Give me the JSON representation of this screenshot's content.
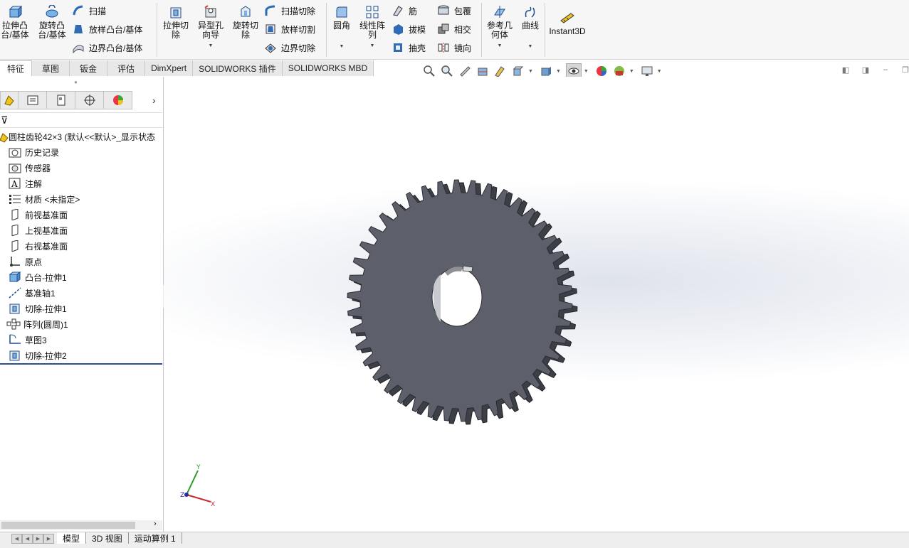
{
  "ribbon": {
    "large_buttons": [
      {
        "id": "extrude-boss",
        "label": "拉伸凸\n台/基体",
        "icon": "extrude-boss-icon"
      },
      {
        "id": "revolve-boss",
        "label": "旋转凸\n台/基体",
        "icon": "revolve-boss-icon"
      },
      {
        "id": "extrude-cut",
        "label": "拉伸切\n除",
        "icon": "extrude-cut-icon"
      },
      {
        "id": "hole-wizard",
        "label": "异型孔\n向导",
        "icon": "hole-wizard-icon"
      },
      {
        "id": "revolve-cut",
        "label": "旋转切\n除",
        "icon": "revolve-cut-icon"
      },
      {
        "id": "fillet",
        "label": "圆角",
        "icon": "fillet-icon"
      },
      {
        "id": "linear-pattern",
        "label": "线性阵\n列",
        "icon": "linear-pattern-icon"
      },
      {
        "id": "ref-geometry",
        "label": "参考几\n何体",
        "icon": "reference-geometry-icon"
      },
      {
        "id": "curves",
        "label": "曲线",
        "icon": "curves-icon"
      },
      {
        "id": "instant3d",
        "label": "Instant3D",
        "icon": "instant3d-icon"
      }
    ],
    "small_buttons": [
      {
        "id": "sweep",
        "label": "扫描",
        "icon": "sweep-icon"
      },
      {
        "id": "loft",
        "label": "放样凸台/基体",
        "icon": "loft-icon"
      },
      {
        "id": "boundary-boss",
        "label": "边界凸台/基体",
        "icon": "boundary-boss-icon"
      },
      {
        "id": "swept-cut",
        "label": "扫描切除",
        "icon": "swept-cut-icon"
      },
      {
        "id": "lofted-cut",
        "label": "放样切割",
        "icon": "lofted-cut-icon"
      },
      {
        "id": "boundary-cut",
        "label": "边界切除",
        "icon": "boundary-cut-icon"
      },
      {
        "id": "rib",
        "label": "筋",
        "icon": "rib-icon"
      },
      {
        "id": "draft",
        "label": "拔模",
        "icon": "draft-icon"
      },
      {
        "id": "shell",
        "label": "抽壳",
        "icon": "shell-icon"
      },
      {
        "id": "wrap",
        "label": "包覆",
        "icon": "wrap-icon"
      },
      {
        "id": "intersect",
        "label": "相交",
        "icon": "intersect-icon"
      },
      {
        "id": "mirror",
        "label": "镜向",
        "icon": "mirror-icon"
      }
    ]
  },
  "command_tabs": [
    "特征",
    "草图",
    "钣金",
    "评估",
    "DimXpert",
    "SOLIDWORKS 插件",
    "SOLIDWORKS MBD"
  ],
  "active_command_tab": "特征",
  "feature_tree": {
    "root": "圆柱齿轮42×3  (默认<<默认>_显示状态",
    "items": [
      {
        "label": "历史记录",
        "icon": "history-folder-icon"
      },
      {
        "label": "传感器",
        "icon": "sensor-icon"
      },
      {
        "label": "注解",
        "icon": "annotation-icon"
      },
      {
        "label": "材质 <未指定>",
        "icon": "material-icon"
      },
      {
        "label": "前视基准面",
        "icon": "plane-icon"
      },
      {
        "label": "上视基准面",
        "icon": "plane-icon"
      },
      {
        "label": "右视基准面",
        "icon": "plane-icon"
      },
      {
        "label": "原点",
        "icon": "origin-icon"
      },
      {
        "label": "凸台-拉伸1",
        "icon": "boss-extrude-icon"
      },
      {
        "label": "基准轴1",
        "icon": "axis-icon"
      },
      {
        "label": "切除-拉伸1",
        "icon": "cut-extrude-icon"
      },
      {
        "label": "阵列(圆周)1",
        "icon": "circular-pattern-icon"
      },
      {
        "label": "草图3",
        "icon": "sketch-icon"
      },
      {
        "label": "切除-拉伸2",
        "icon": "cut-extrude-icon"
      }
    ]
  },
  "bottom_tabs": [
    "模型",
    "3D 视图",
    "运动算例 1"
  ],
  "active_bottom_tab": "模型",
  "triad": {
    "x": "X",
    "y": "Y",
    "z": "Z"
  },
  "colors": {
    "gear_face": "#5d606b",
    "gear_side": "#3d3f46",
    "accent": "#2a4f9a"
  }
}
